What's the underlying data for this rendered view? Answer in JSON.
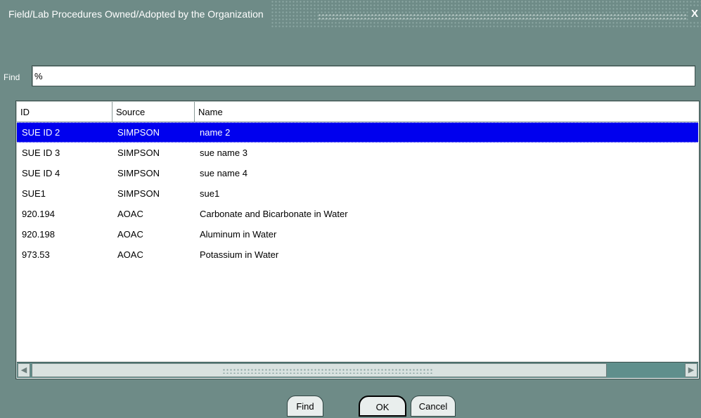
{
  "window": {
    "title": "Field/Lab Procedures Owned/Adopted by the Organization",
    "close_glyph": "X"
  },
  "find": {
    "label": "Find",
    "value": "%"
  },
  "list": {
    "columns": [
      "ID",
      "Source",
      "Name"
    ],
    "rows": [
      {
        "id": "SUE ID 2",
        "source": "SIMPSON",
        "name": "name 2",
        "selected": true
      },
      {
        "id": "SUE ID 3",
        "source": "SIMPSON",
        "name": "sue name 3"
      },
      {
        "id": "SUE ID 4",
        "source": "SIMPSON",
        "name": "sue name 4"
      },
      {
        "id": "SUE1",
        "source": "SIMPSON",
        "name": "sue1"
      },
      {
        "id": "920.194",
        "source": "AOAC",
        "name": "Carbonate and Bicarbonate in Water"
      },
      {
        "id": "920.198",
        "source": "AOAC",
        "name": "Aluminum in Water"
      },
      {
        "id": "973.53",
        "source": "AOAC",
        "name": "Potassium in Water"
      }
    ],
    "selected_color": "#0000ee"
  },
  "scrollbar": {
    "left_icon": "arrow-left-icon",
    "right_icon": "arrow-right-icon"
  },
  "buttons": {
    "find": "Find",
    "ok": "OK",
    "cancel": "Cancel"
  }
}
